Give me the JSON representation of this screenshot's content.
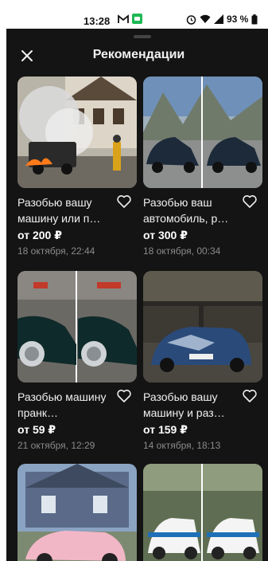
{
  "status": {
    "time": "13:28",
    "battery": "93 %"
  },
  "header": {
    "title": "Рекомендации"
  },
  "items": [
    {
      "title": "Разобью вашу машину или п…",
      "price": "от 200 ₽",
      "date": "18 октября, 22:44"
    },
    {
      "title": "Разобью ваш автомобиль, р…",
      "price": "от 300 ₽",
      "date": "18 октября, 00:34"
    },
    {
      "title": "Разобью машину пранк…",
      "price": "от 59 ₽",
      "date": "21 октября, 12:29"
    },
    {
      "title": "Разобью вашу машину и раз…",
      "price": "от 159 ₽",
      "date": "14 октября, 18:13"
    },
    {
      "title": "",
      "price": "",
      "date": ""
    },
    {
      "title": "",
      "price": "",
      "date": ""
    }
  ],
  "colors": {
    "background": "#141414",
    "text": "#f0f0f0",
    "muted": "#8a8a8a"
  }
}
